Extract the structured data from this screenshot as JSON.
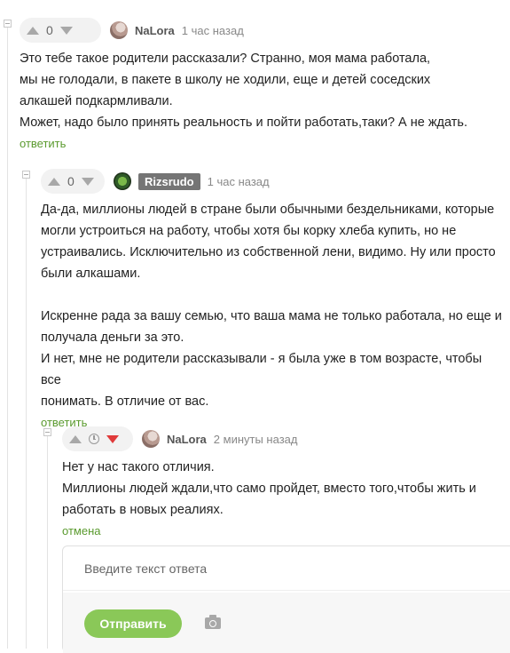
{
  "comments": [
    {
      "votes": "0",
      "username": "NaLora",
      "time": "1 час назад",
      "lines": [
        "Это тебе такое родители рассказали? Странно, моя мама работала,",
        "мы не голодали, в пакете в школу не ходили, еще и детей соседских",
        "алкашей подкармливали.",
        "Может, надо было принять реальность и пойти работать,таки? А не ждать."
      ],
      "action": "ответить"
    },
    {
      "votes": "0",
      "username": "Rizsrudo",
      "time": "1 час назад",
      "lines_a": [
        "Да-да, миллионы людей в стране были обычными бездельниками, которые",
        "могли устроиться на работу, чтобы хотя бы корку хлеба купить, но не",
        "устраивались. Исключительно из собственной лени, видимо. Ну или просто",
        "были алкашами."
      ],
      "lines_b": [
        "Искренне рада за вашу семью, что ваша мама не только работала, но еще и",
        "получала деньги за это.",
        "И нет, мне не родители рассказывали - я была уже в том возрасте, чтобы все",
        "понимать. В отличие от вас."
      ],
      "action": "ответить"
    },
    {
      "username": "NaLora",
      "time": "2 минуты назад",
      "lines": [
        "Нет у нас такого отличия.",
        "Миллионы людей ждали,что само пройдет, вместо того,чтобы жить и",
        "работать в новых реалиях."
      ],
      "action": "отмена"
    }
  ],
  "reply_form": {
    "placeholder": "Введите текст ответа",
    "submit_label": "Отправить"
  },
  "colors": {
    "link_green": "#5a9a2e",
    "button_green": "#8ac858",
    "downvote_red": "#e03a3a"
  }
}
